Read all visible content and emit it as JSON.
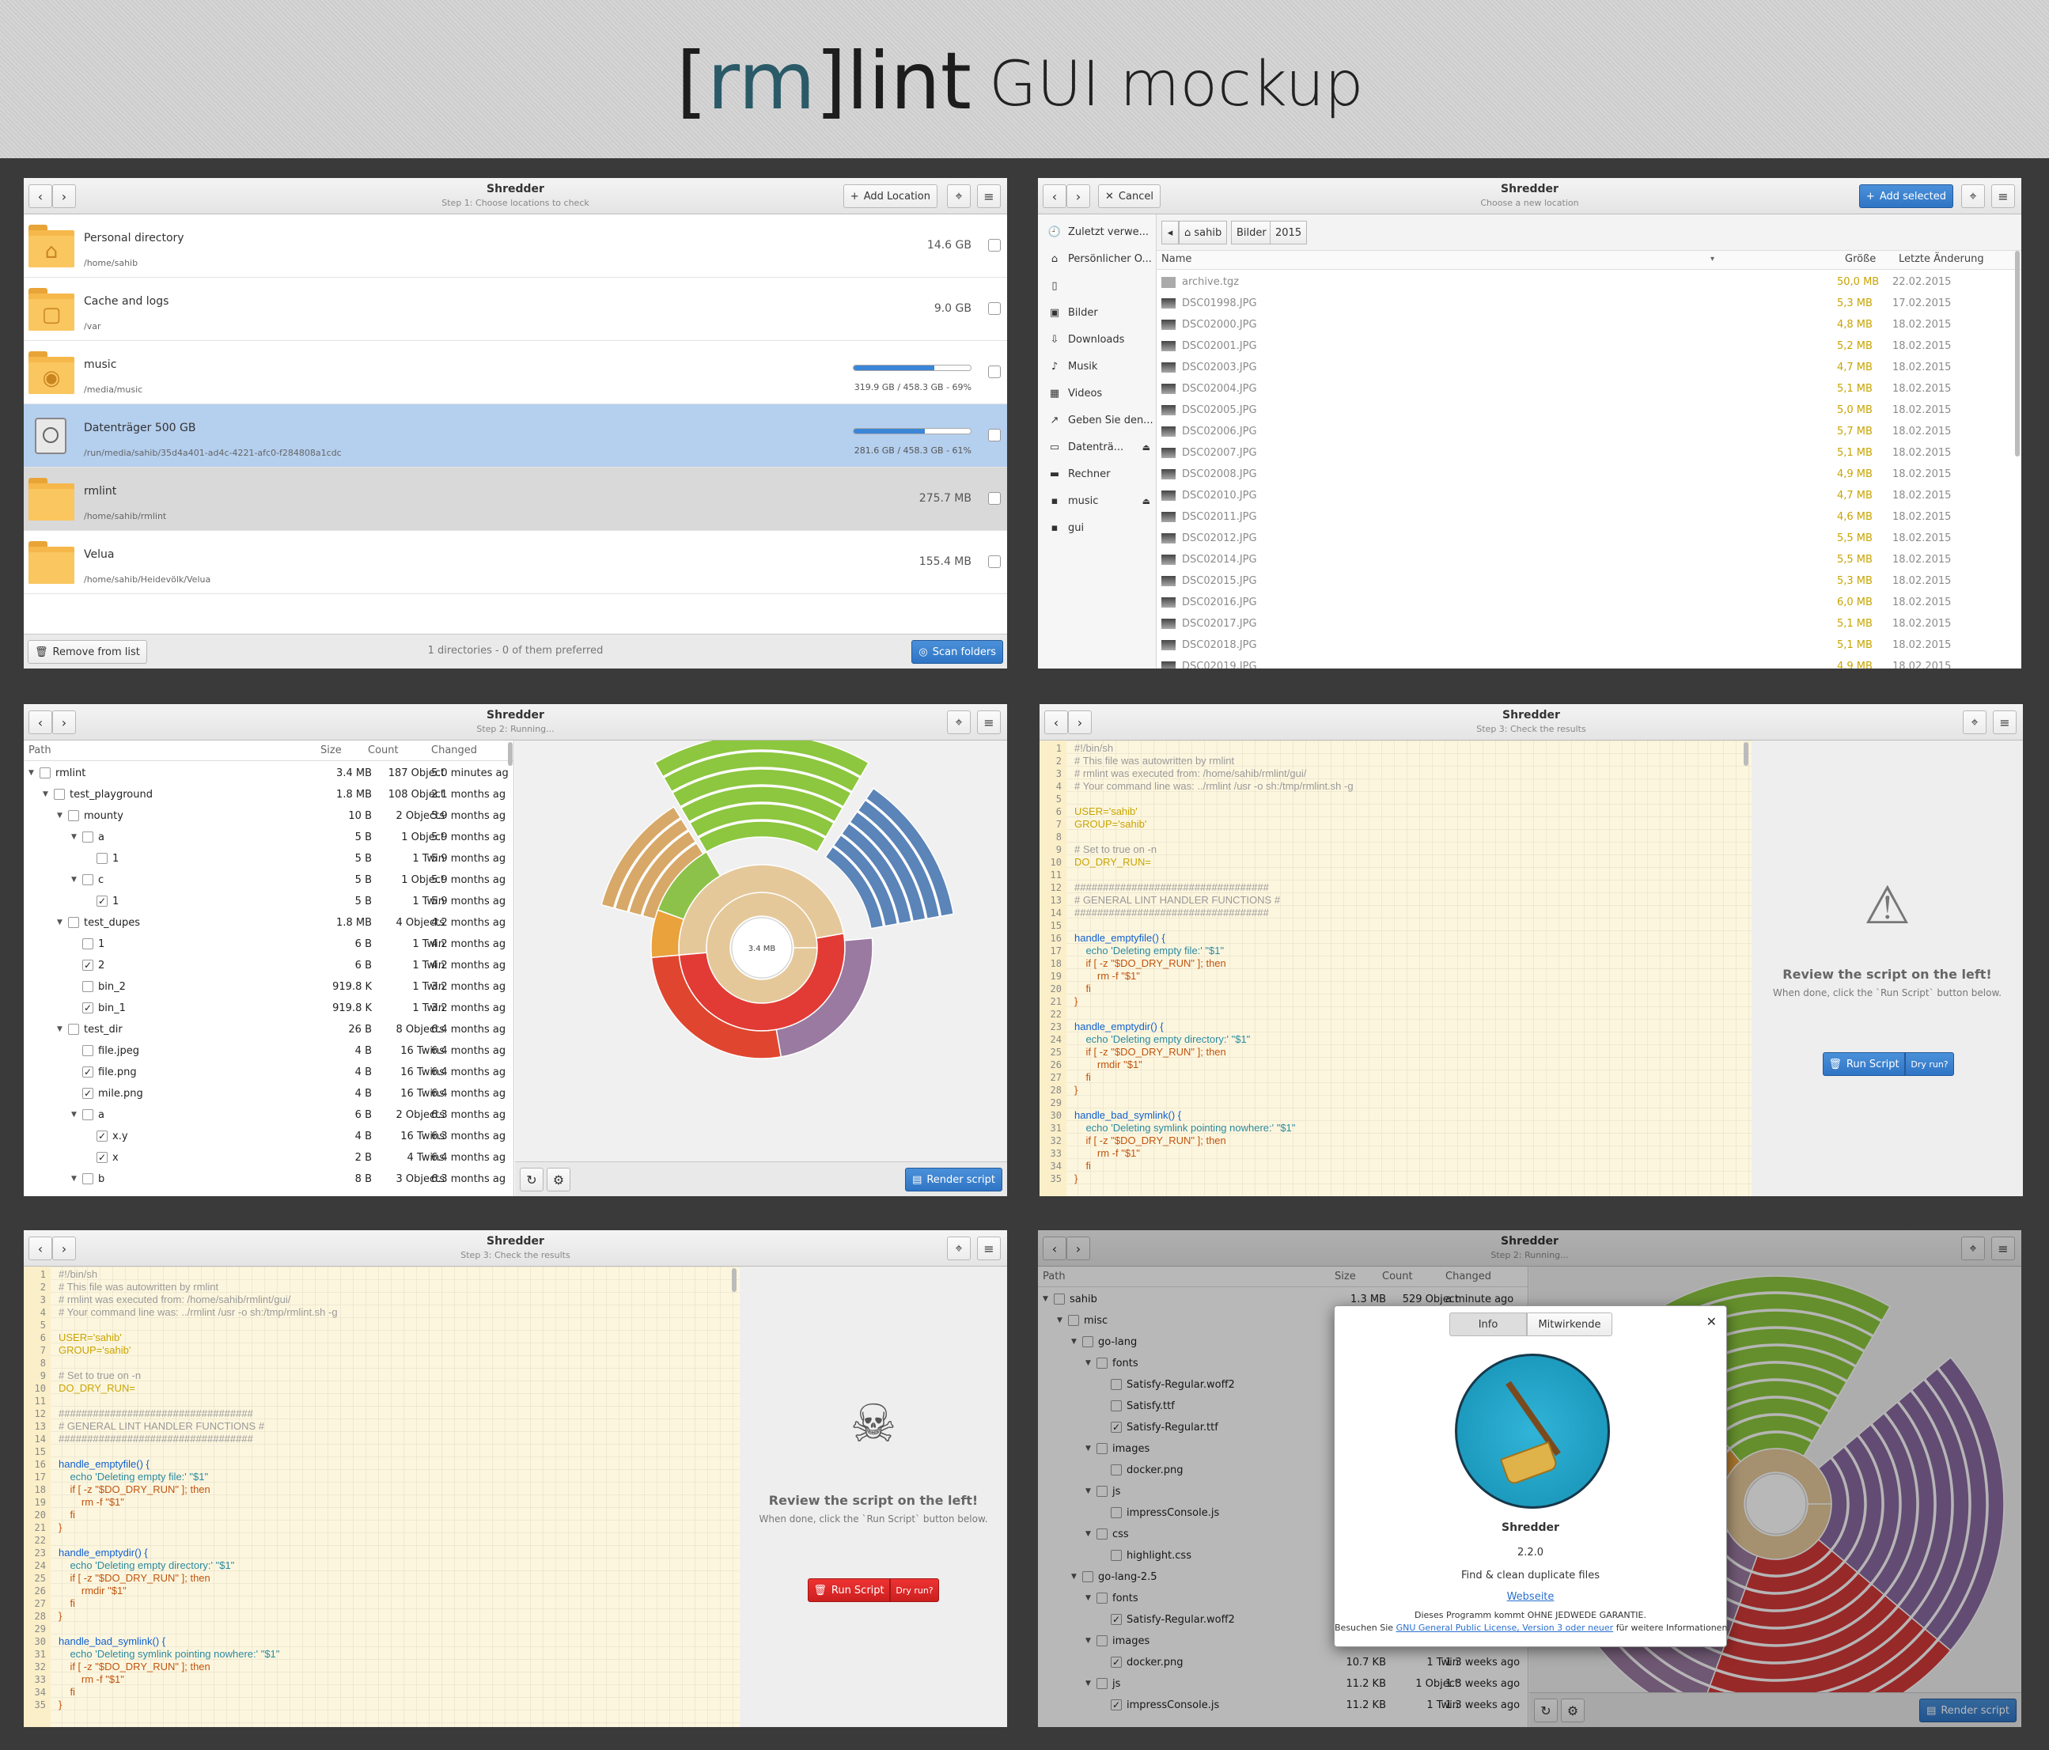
{
  "header": {
    "logo_open": "[",
    "logo_rm": "rm",
    "logo_close": "]",
    "logo_lint": "lint",
    "subtitle": "GUI mockup"
  },
  "app": {
    "name": "Shredder"
  },
  "w1": {
    "subtitle": "Step 1: Choose locations to check",
    "add_location": "Add Location",
    "remove": "Remove from list",
    "status": "1 directories - 0 of them preferred",
    "scan": "Scan folders",
    "rows": [
      {
        "name": "Personal directory",
        "path": "/home/sahib",
        "size": "14.6 GB"
      },
      {
        "name": "Cache and logs",
        "path": "/var",
        "size": "9.0 GB"
      },
      {
        "name": "music",
        "path": "/media/music",
        "bar_text": "319.9 GB / 458.3 GB - 69%",
        "fill": 0.69
      },
      {
        "name": "Datenträger 500 GB",
        "path": "/run/media/sahib/35d4a401-ad4c-4221-afc0-f284808a1cdc",
        "bar_text": "281.6 GB / 458.3 GB - 61%",
        "fill": 0.61
      },
      {
        "name": "rmlint",
        "path": "/home/sahib/rmlint",
        "size": "275.7 MB"
      },
      {
        "name": "Velua",
        "path": "/home/sahib/Heidevölk/Velua",
        "size": "155.4 MB"
      }
    ]
  },
  "w2": {
    "cancel": "Cancel",
    "subtitle": "Choose a new location",
    "add_selected": "Add selected",
    "sidebar": [
      "Zuletzt verwe...",
      "Persönlicher O...",
      "",
      "Bilder",
      "Downloads",
      "Musik",
      "Videos",
      "Geben Sie den...",
      "Datenträ...",
      "Rechner",
      "music",
      "gui"
    ],
    "crumbs": [
      "sahib",
      "Bilder",
      "2015"
    ],
    "cols": {
      "name": "Name",
      "size": "Größe",
      "date": "Letzte Änderung"
    },
    "files": [
      [
        "archive.tgz",
        "50,0 MB",
        "22.02.2015"
      ],
      [
        "DSC01998.JPG",
        "5,3 MB",
        "17.02.2015"
      ],
      [
        "DSC02000.JPG",
        "4,8 MB",
        "18.02.2015"
      ],
      [
        "DSC02001.JPG",
        "5,2 MB",
        "18.02.2015"
      ],
      [
        "DSC02003.JPG",
        "4,7 MB",
        "18.02.2015"
      ],
      [
        "DSC02004.JPG",
        "5,1 MB",
        "18.02.2015"
      ],
      [
        "DSC02005.JPG",
        "5,0 MB",
        "18.02.2015"
      ],
      [
        "DSC02006.JPG",
        "5,7 MB",
        "18.02.2015"
      ],
      [
        "DSC02007.JPG",
        "5,1 MB",
        "18.02.2015"
      ],
      [
        "DSC02008.JPG",
        "4,9 MB",
        "18.02.2015"
      ],
      [
        "DSC02010.JPG",
        "4,7 MB",
        "18.02.2015"
      ],
      [
        "DSC02011.JPG",
        "4,6 MB",
        "18.02.2015"
      ],
      [
        "DSC02012.JPG",
        "5,5 MB",
        "18.02.2015"
      ],
      [
        "DSC02014.JPG",
        "5,5 MB",
        "18.02.2015"
      ],
      [
        "DSC02015.JPG",
        "5,3 MB",
        "18.02.2015"
      ],
      [
        "DSC02016.JPG",
        "6,0 MB",
        "18.02.2015"
      ],
      [
        "DSC02017.JPG",
        "5,1 MB",
        "18.02.2015"
      ],
      [
        "DSC02018.JPG",
        "5,1 MB",
        "18.02.2015"
      ],
      [
        "DSC02019.JPG",
        "4,9 MB",
        "18.02.2015"
      ]
    ]
  },
  "w3": {
    "subtitle": "Step 2: Running...",
    "cols": {
      "path": "Path",
      "size": "Size",
      "count": "Count",
      "changed": "Changed"
    },
    "center": "3.4 MB",
    "render": "Render script",
    "rows": [
      [
        0,
        "v",
        0,
        "rmlint",
        "3.4 MB",
        "187 Object",
        "5.0 minutes ag"
      ],
      [
        1,
        "v",
        0,
        "test_playground",
        "1.8 MB",
        "108 Object",
        "2.1 months ag"
      ],
      [
        2,
        "v",
        0,
        "mounty",
        "10 B",
        "2 Objects",
        "5.9 months ag"
      ],
      [
        3,
        "v",
        0,
        "a",
        "5 B",
        "1 Object",
        "5.9 months ag"
      ],
      [
        4,
        "",
        0,
        "1",
        "5 B",
        "1 Twin",
        "5.9 months ag"
      ],
      [
        3,
        "v",
        0,
        "c",
        "5 B",
        "1 Object",
        "5.9 months ag"
      ],
      [
        4,
        "",
        1,
        "1",
        "5 B",
        "1 Twin",
        "5.9 months ag"
      ],
      [
        2,
        "v",
        0,
        "test_dupes",
        "1.8 MB",
        "4 Objects",
        "4.2 months ag"
      ],
      [
        3,
        "",
        0,
        "1",
        "6 B",
        "1 Twin",
        "4.2 months ag"
      ],
      [
        3,
        "",
        1,
        "2",
        "6 B",
        "1 Twin",
        "4.2 months ag"
      ],
      [
        3,
        "",
        0,
        "bin_2",
        "919.8 K",
        "1 Twin",
        "3.2 months ag"
      ],
      [
        3,
        "",
        1,
        "bin_1",
        "919.8 K",
        "1 Twin",
        "3.2 months ag"
      ],
      [
        2,
        "v",
        0,
        "test_dir",
        "26 B",
        "8 Objects",
        "6.4 months ag"
      ],
      [
        3,
        "",
        0,
        "file.jpeg",
        "4 B",
        "16 Twins",
        "6.4 months ag"
      ],
      [
        3,
        "",
        1,
        "file.png",
        "4 B",
        "16 Twins",
        "6.4 months ag"
      ],
      [
        3,
        "",
        1,
        "mile.png",
        "4 B",
        "16 Twins",
        "6.4 months ag"
      ],
      [
        3,
        "v",
        0,
        "a",
        "6 B",
        "2 Objects",
        "6.3 months ag"
      ],
      [
        4,
        "",
        1,
        "x.y",
        "4 B",
        "16 Twins",
        "6.3 months ag"
      ],
      [
        4,
        "",
        1,
        "x",
        "2 B",
        "4 Twins",
        "6.4 months ag"
      ],
      [
        3,
        "v",
        0,
        "b",
        "8 B",
        "3 Objects",
        "6.3 months ag"
      ]
    ]
  },
  "script": {
    "lines": [
      [
        "1",
        "#!/bin/sh",
        "c"
      ],
      [
        "2",
        "# This file was autowritten by rmlint",
        "c"
      ],
      [
        "3",
        "# rmlint was executed from: /home/sahib/rmlint/gui/",
        "c"
      ],
      [
        "4",
        "# Your command line was: ../rmlint /usr -o sh:/tmp/rmlint.sh -g",
        "c"
      ],
      [
        "5",
        "",
        ""
      ],
      [
        "6",
        "USER='sahib'",
        "s"
      ],
      [
        "7",
        "GROUP='sahib'",
        "s"
      ],
      [
        "8",
        "",
        ""
      ],
      [
        "9",
        "# Set to true on -n",
        "c"
      ],
      [
        "10",
        "DO_DRY_RUN=",
        "s"
      ],
      [
        "11",
        "",
        ""
      ],
      [
        "12",
        "##################################",
        "c"
      ],
      [
        "13",
        "# GENERAL LINT HANDLER FUNCTIONS #",
        "c"
      ],
      [
        "14",
        "##################################",
        "c"
      ],
      [
        "15",
        "",
        ""
      ],
      [
        "16",
        "handle_emptyfile() {",
        "f"
      ],
      [
        "17",
        "    echo 'Deleting empty file:' \"$1\"",
        "st"
      ],
      [
        "18",
        "    if [ -z \"$DO_DRY_RUN\" ]; then",
        "k"
      ],
      [
        "19",
        "        rm -f \"$1\"",
        "k"
      ],
      [
        "20",
        "    fi",
        "k"
      ],
      [
        "21",
        "}",
        "k"
      ],
      [
        "22",
        "",
        ""
      ],
      [
        "23",
        "handle_emptydir() {",
        "f"
      ],
      [
        "24",
        "    echo 'Deleting empty directory:' \"$1\"",
        "st"
      ],
      [
        "25",
        "    if [ -z \"$DO_DRY_RUN\" ]; then",
        "k"
      ],
      [
        "26",
        "        rmdir \"$1\"",
        "k"
      ],
      [
        "27",
        "    fi",
        "k"
      ],
      [
        "28",
        "}",
        "k"
      ],
      [
        "29",
        "",
        ""
      ],
      [
        "30",
        "handle_bad_symlink() {",
        "f"
      ],
      [
        "31",
        "    echo 'Deleting symlink pointing nowhere:' \"$1\"",
        "st"
      ],
      [
        "32",
        "    if [ -z \"$DO_DRY_RUN\" ]; then",
        "k"
      ],
      [
        "33",
        "        rm -f \"$1\"",
        "k"
      ],
      [
        "34",
        "    fi",
        "k"
      ],
      [
        "35",
        "}",
        "k"
      ]
    ]
  },
  "w4": {
    "subtitle": "Step 3: Check the results",
    "review": "Review the script on the left!",
    "review_sub": "When done, click the `Run Script` button below.",
    "run": "Run Script",
    "dry": "Dry run?"
  },
  "w6": {
    "subtitle": "Step 2: Running...",
    "tab_info": "Info",
    "tab_credits": "Mitwirkende",
    "app_name": "Shredder",
    "version": "2.2.0",
    "desc": "Find & clean duplicate files",
    "website": "Webseite",
    "warranty": "Dieses Programm kommt OHNE JEDWEDE GARANTIE.",
    "license_pre": "Besuchen Sie",
    "license_link": "GNU General Public License, Version 3 oder neuer",
    "license_post": "für weitere Informationen.",
    "render": "Render script",
    "rows": [
      [
        0,
        "v",
        0,
        "sahib",
        "1.3 MB",
        "529 Object",
        "a minute ago"
      ],
      [
        1,
        "v",
        0,
        "misc",
        "",
        "",
        ""
      ],
      [
        2,
        "v",
        0,
        "go-lang",
        "",
        "",
        ""
      ],
      [
        3,
        "v",
        0,
        "fonts",
        "",
        "",
        ""
      ],
      [
        4,
        "",
        0,
        "Satisfy-Regular.woff2",
        "",
        "",
        ""
      ],
      [
        4,
        "",
        0,
        "Satisfy.ttf",
        "",
        "",
        ""
      ],
      [
        4,
        "",
        1,
        "Satisfy-Regular.ttf",
        "",
        "",
        ""
      ],
      [
        3,
        "v",
        0,
        "images",
        "",
        "",
        ""
      ],
      [
        4,
        "",
        0,
        "docker.png",
        "",
        "",
        ""
      ],
      [
        3,
        "v",
        0,
        "js",
        "",
        "",
        ""
      ],
      [
        4,
        "",
        0,
        "impressConsole.js",
        "",
        "",
        ""
      ],
      [
        3,
        "v",
        0,
        "css",
        "",
        "",
        ""
      ],
      [
        4,
        "",
        0,
        "highlight.css",
        "",
        "",
        ""
      ],
      [
        2,
        "v",
        0,
        "go-lang-2.5",
        "",
        "",
        ""
      ],
      [
        3,
        "v",
        0,
        "fonts",
        "",
        "",
        ""
      ],
      [
        4,
        "",
        1,
        "Satisfy-Regular.woff2",
        "",
        "",
        ""
      ],
      [
        3,
        "v",
        0,
        "images",
        "",
        "",
        ""
      ],
      [
        4,
        "",
        1,
        "docker.png",
        "10.7 KB",
        "1 Twin",
        "1.3 weeks ago"
      ],
      [
        3,
        "v",
        0,
        "js",
        "11.2 KB",
        "1 Object",
        "1.3 weeks ago"
      ],
      [
        4,
        "",
        1,
        "impressConsole.js",
        "11.2 KB",
        "1 Twin",
        "1.3 weeks ago"
      ]
    ]
  }
}
